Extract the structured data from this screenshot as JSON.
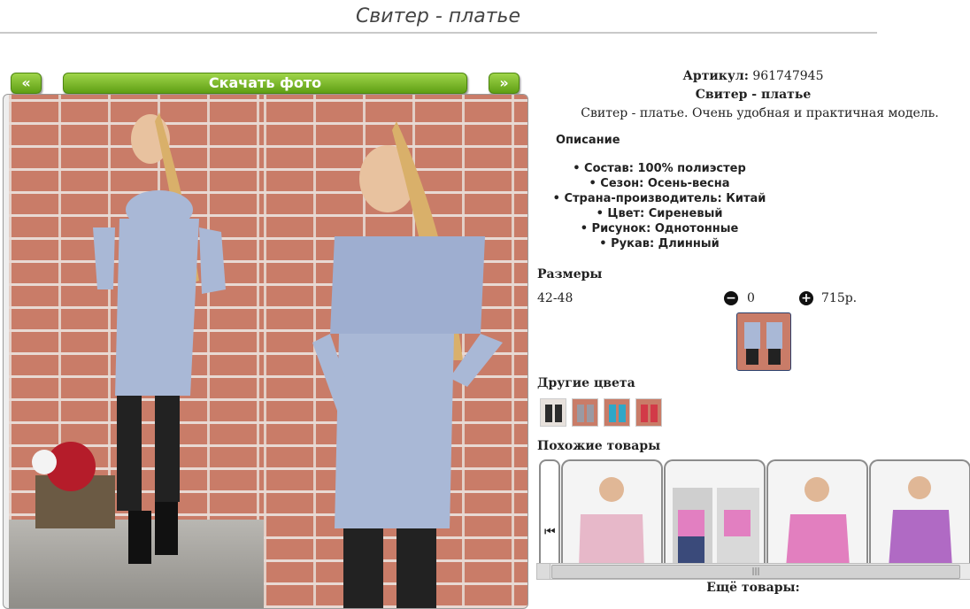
{
  "page": {
    "title": "Свитер - платье"
  },
  "gallery": {
    "prev_label": "«",
    "download_label": "Скачать фото",
    "next_label": "»"
  },
  "product": {
    "article_label": "Артикул:",
    "article_value": "961747945",
    "name": "Свитер - платье",
    "short_text": "Свитер - платье. Очень удобная и практичная модель.",
    "description_heading": "Описание",
    "features": [
      "Состав: 100% полиэстер",
      "Сезон: Осень-весна",
      "Страна-производитель: Китай",
      "Цвет: Сиреневый",
      "Рисунок: Однотонные",
      "Рукав: Длинный"
    ],
    "sizes_heading": "Размеры",
    "size_value": "42-48",
    "minus_icon": "minus-circle-icon",
    "quantity": "0",
    "plus_icon": "plus-circle-icon",
    "price": "715р.",
    "other_colors_heading": "Другие цвета",
    "other_colors": [
      "#2b2b2b",
      "#9a9aa3",
      "#2fa7c7",
      "#d23a48"
    ],
    "similar_heading": "Похожие товары",
    "similar_prev_icon": "skip-back-icon",
    "similar_items": [
      {
        "color": "#e7b8c9"
      },
      {
        "color": "#e27fc1"
      },
      {
        "color": "#e27fbf"
      },
      {
        "color": "#b06ac4"
      }
    ],
    "scroll_grip": "|||",
    "more_label": "Ещё товары:"
  },
  "colors": {
    "nav_green": "#6aab1a",
    "sweater": "#a9b8d6",
    "brick": "#c97c68"
  }
}
